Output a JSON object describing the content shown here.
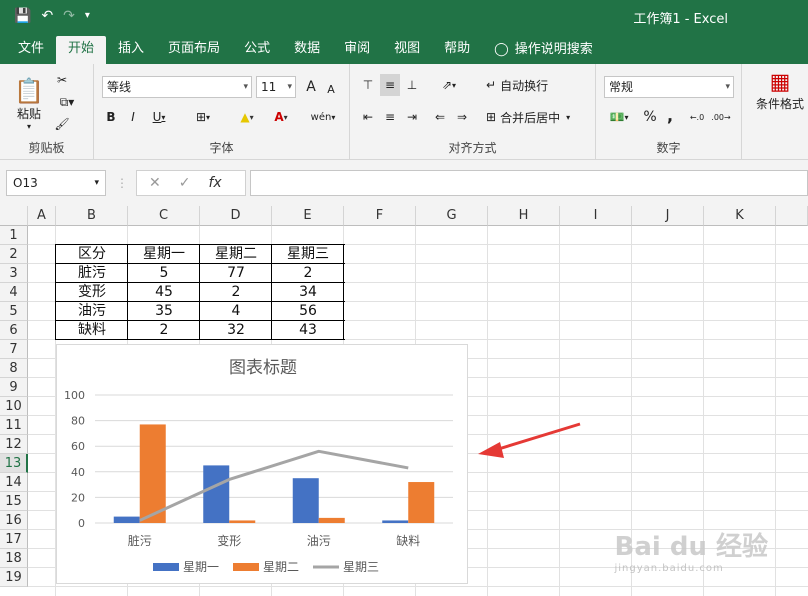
{
  "title": "工作簿1  -  Excel",
  "tabs": [
    "文件",
    "开始",
    "插入",
    "页面布局",
    "公式",
    "数据",
    "审阅",
    "视图",
    "帮助",
    "操作说明搜索"
  ],
  "ribbon": {
    "clipboard": {
      "paste": "粘贴",
      "label": "剪贴板"
    },
    "font": {
      "name": "等线",
      "size": "11",
      "label": "字体",
      "bold": "B",
      "italic": "I",
      "underline": "U",
      "grow": "A",
      "shrink": "A",
      "color_a": "A"
    },
    "align": {
      "wrap": "自动换行",
      "merge": "合并后居中",
      "label": "对齐方式"
    },
    "number": {
      "format": "常规",
      "label": "数字",
      "percent": "%",
      "comma": ","
    },
    "styles": {
      "cond": "条件格式"
    }
  },
  "formula_bar": {
    "name_box": "O13",
    "fx": "fx",
    "cancel": "✕",
    "enter": "✓"
  },
  "columns": [
    "A",
    "B",
    "C",
    "D",
    "E",
    "F",
    "G",
    "H",
    "I",
    "J",
    "K"
  ],
  "rows": [
    "1",
    "2",
    "3",
    "4",
    "5",
    "6",
    "7",
    "8",
    "9",
    "10",
    "11",
    "12",
    "13",
    "14",
    "15",
    "16",
    "17",
    "18",
    "19"
  ],
  "table": {
    "header": [
      "区分",
      "星期一",
      "星期二",
      "星期三"
    ],
    "rows": [
      [
        "脏污",
        "5",
        "77",
        "2"
      ],
      [
        "变形",
        "45",
        "2",
        "34"
      ],
      [
        "油污",
        "35",
        "4",
        "56"
      ],
      [
        "缺料",
        "2",
        "32",
        "43"
      ]
    ]
  },
  "chart_data": {
    "type": "bar",
    "title": "图表标题",
    "categories": [
      "脏污",
      "变形",
      "油污",
      "缺料"
    ],
    "series": [
      {
        "name": "星期一",
        "type": "bar",
        "color": "#4472c4",
        "values": [
          5,
          45,
          35,
          2
        ]
      },
      {
        "name": "星期二",
        "type": "bar",
        "color": "#ed7d31",
        "values": [
          77,
          2,
          4,
          32
        ]
      },
      {
        "name": "星期三",
        "type": "line",
        "color": "#a5a5a5",
        "values": [
          2,
          34,
          56,
          43
        ]
      }
    ],
    "yticks": [
      "0",
      "20",
      "40",
      "60",
      "80",
      "100"
    ],
    "ylim": [
      0,
      100
    ],
    "grid": true,
    "legend": "bottom"
  },
  "watermark": {
    "main": "Bai du 经验",
    "sub": "jingyan.baidu.com"
  },
  "colors": {
    "excel_green": "#217346",
    "arrow": "#e53935"
  }
}
